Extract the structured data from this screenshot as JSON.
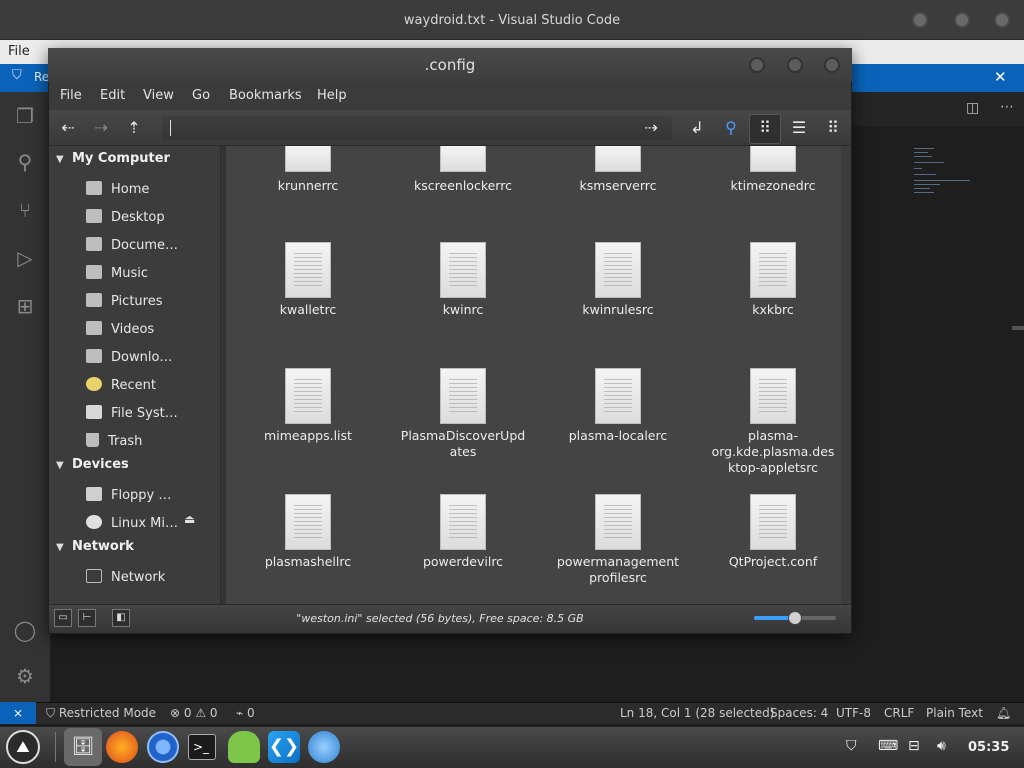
{
  "vscode": {
    "title": "waydroid.txt - Visual Studio Code",
    "menu_file": "File",
    "banner_text": "Re",
    "banner_close": "✕",
    "status": {
      "restricted": "Restricted Mode",
      "problems": "⊗ 0 ⚠ 0",
      "ports": "0",
      "cursor": "Ln 18, Col 1 (28 selected)",
      "spaces": "Spaces: 4",
      "encoding": "UTF-8",
      "eol": "CRLF",
      "language": "Plain Text"
    }
  },
  "fm": {
    "title": ".config",
    "menu": [
      "File",
      "Edit",
      "View",
      "Go",
      "Bookmarks",
      "Help"
    ],
    "sidebar": {
      "my_computer": "My Computer",
      "places": [
        "Home",
        "Desktop",
        "Docume…",
        "Music",
        "Pictures",
        "Videos",
        "Downlo…",
        "Recent",
        "File Syst…",
        "Trash"
      ],
      "devices_head": "Devices",
      "devices": [
        "Floppy …",
        "Linux Mi…"
      ],
      "network_head": "Network",
      "network": [
        "Network"
      ]
    },
    "files_top_row": [
      "krunnerrc",
      "kscreenlockerrc",
      "ksmserverrc",
      "ktimezonedrc"
    ],
    "files": [
      [
        "kwalletrc",
        "kwinrc",
        "kwinrulesrc",
        "kxkbrc"
      ],
      [
        "mimeapps.list",
        "PlasmaDiscoverUpdates",
        "plasma-localerc",
        "plasma-org.kde.plasma.desktop-appletsrc"
      ],
      [
        "plasmashellrc",
        "powerdevilrc",
        "powermanagementprofilesrc",
        "QtProject.conf"
      ]
    ],
    "status": "\"weston.ini\" selected (56 bytes), Free space: 8.5 GB",
    "zoom_level": 0.5
  },
  "taskbar": {
    "clock": "05:35"
  }
}
